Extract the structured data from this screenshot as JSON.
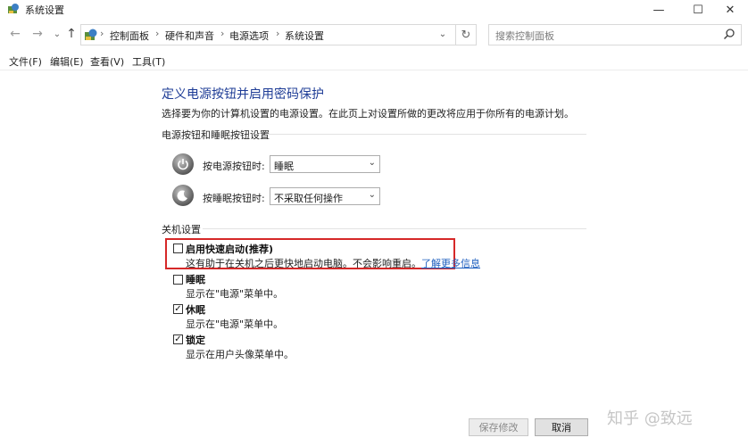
{
  "window": {
    "title": "系统设置",
    "controls": {
      "minimize": "—",
      "maximize": "☐",
      "close": "✕"
    }
  },
  "nav": {
    "back": "←",
    "forward": "→",
    "recent": "⌄",
    "up": "↑"
  },
  "address": {
    "breadcrumbs": [
      "控制面板",
      "硬件和声音",
      "电源选项",
      "系统设置"
    ],
    "separator": "›",
    "dropdown": "⌄",
    "refresh": "↻"
  },
  "search": {
    "placeholder": "搜索控制面板"
  },
  "menu": {
    "file": "文件(F)",
    "edit": "编辑(E)",
    "view": "查看(V)",
    "tools": "工具(T)"
  },
  "page": {
    "heading": "定义电源按钮并启用密码保护",
    "description": "选择要为你的计算机设置的电源设置。在此页上对设置所做的更改将应用于你所有的电源计划。"
  },
  "power_section": {
    "title": "电源按钮和睡眠按钮设置",
    "power_button": {
      "label": "按电源按钮时:",
      "value": "睡眠"
    },
    "sleep_button": {
      "label": "按睡眠按钮时:",
      "value": "不采取任何操作"
    }
  },
  "shutdown_section": {
    "title": "关机设置",
    "items": [
      {
        "label": "启用快速启动(推荐)",
        "desc": "这有助于在关机之后更快地启动电脑。不会影响重启。",
        "link": "了解更多信息",
        "checked": false
      },
      {
        "label": "睡眠",
        "desc": "显示在\"电源\"菜单中。",
        "checked": false
      },
      {
        "label": "休眠",
        "desc": "显示在\"电源\"菜单中。",
        "checked": true
      },
      {
        "label": "锁定",
        "desc": "显示在用户头像菜单中。",
        "checked": true
      }
    ]
  },
  "footer": {
    "save": "保存修改",
    "cancel": "取消"
  },
  "watermark": "知乎 @致远",
  "colors": {
    "heading": "#1e3c96",
    "highlight_box": "#d62828",
    "link": "#1e5fbf"
  }
}
